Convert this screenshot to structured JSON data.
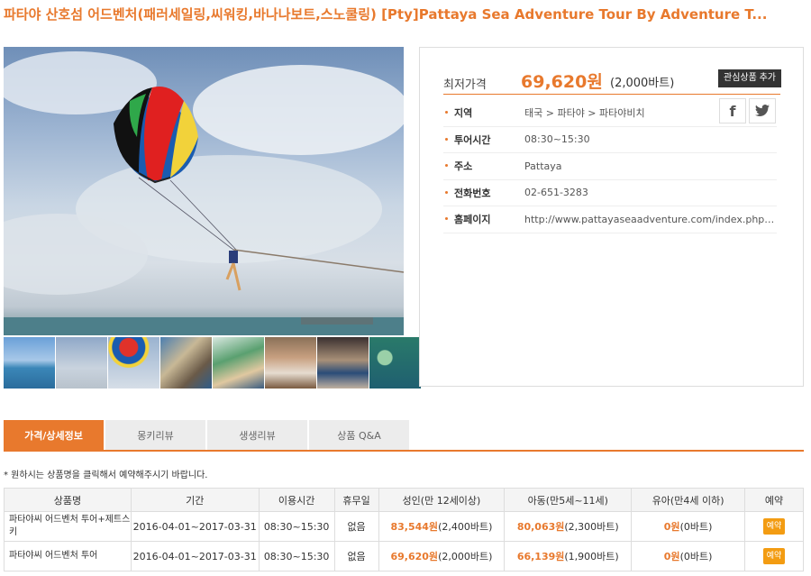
{
  "title": "파타야 산호섬 어드벤처(패러세일링,씨워킹,바나나보트,스노쿨링) [Pty]Pattaya Sea Adventure Tour By Adventure T...",
  "price": {
    "label": "최저가격",
    "value": "69,620원",
    "baht": "(2,000바트)",
    "wishlist_button": "관심상품 추가"
  },
  "social": {
    "facebook": "f",
    "twitter": "t"
  },
  "details": [
    {
      "key": "지역",
      "value": "태국 > 파타야 > 파타야비치"
    },
    {
      "key": "투어시간",
      "value": "08:30~15:30"
    },
    {
      "key": "주소",
      "value": "Pattaya"
    },
    {
      "key": "전화번호",
      "value": "02-651-3283"
    },
    {
      "key": "홈페이지",
      "value": "http://www.pattayaseaadventure.com/index.php?lay..."
    }
  ],
  "tabs": [
    "가격/상세정보",
    "몽키리뷰",
    "생생리뷰",
    "상품 Q&A"
  ],
  "notice": "* 원하시는 상품명을 클릭해서 예약해주시기 바랍니다.",
  "table": {
    "headers": [
      "상품명",
      "기간",
      "이용시간",
      "휴무일",
      "성인(만 12세이상)",
      "아동(만5세~11세)",
      "유아(만4세 이하)",
      "예약"
    ],
    "rows": [
      {
        "name": "파타야씨 어드벤처 투어+제트스키",
        "period": "2016-04-01~2017-03-31",
        "time": "08:30~15:30",
        "closed": "없음",
        "adult_won": "83,544원",
        "adult_baht": "(2,400바트)",
        "child_won": "80,063원",
        "child_baht": "(2,300바트)",
        "infant_won": "0원",
        "infant_baht": "(0바트)",
        "book": "예약"
      },
      {
        "name": "파타야씨 어드벤처 투어",
        "period": "2016-04-01~2017-03-31",
        "time": "08:30~15:30",
        "closed": "없음",
        "adult_won": "69,620원",
        "adult_baht": "(2,000바트)",
        "child_won": "66,139원",
        "child_baht": "(1,900바트)",
        "infant_won": "0원",
        "infant_baht": "(0바트)",
        "book": "예약"
      }
    ]
  },
  "colors": {
    "accent": "#e8792d",
    "book_button": "#f39c12"
  }
}
